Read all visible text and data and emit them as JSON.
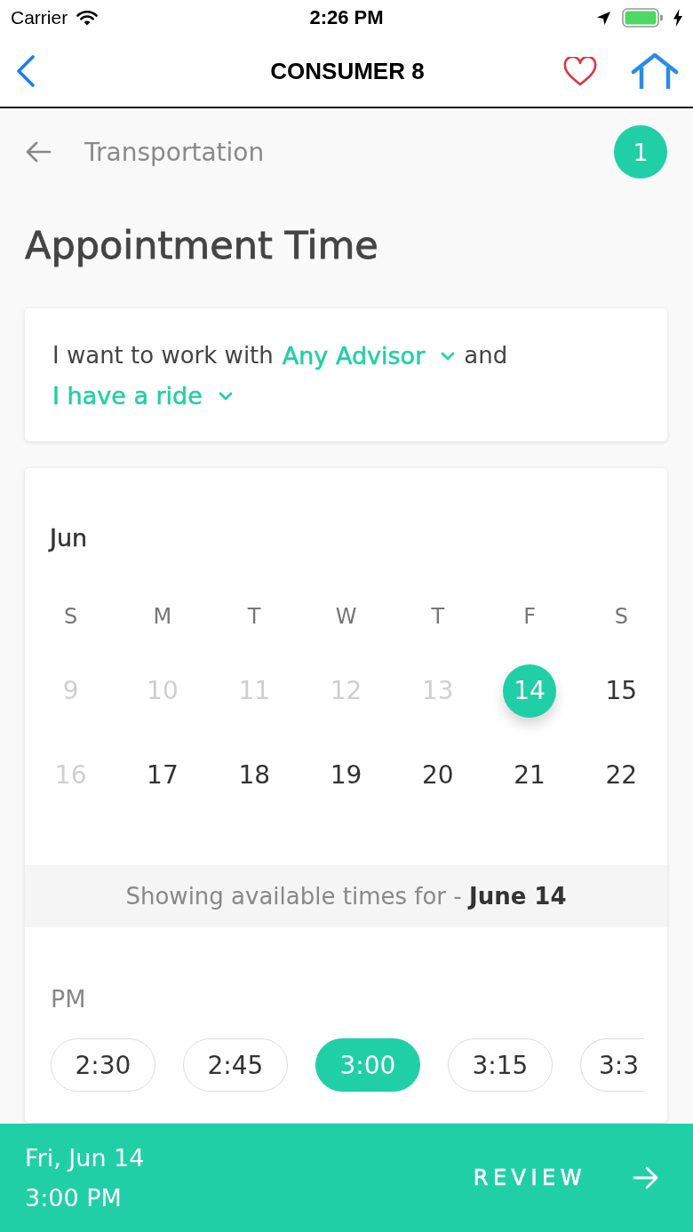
{
  "status_bar": {
    "carrier": "Carrier",
    "time": "2:26 PM"
  },
  "nav_bar": {
    "title": "CONSUMER 8"
  },
  "step_header": {
    "label": "Transportation",
    "badge": "1"
  },
  "page_title": "Appointment Time",
  "preferences": [
    {
      "kind": "text",
      "text": "I want to work with"
    },
    {
      "kind": "dropdown",
      "text": "Any Advisor"
    },
    {
      "kind": "text",
      "text": "and"
    },
    {
      "kind": "dropdown",
      "text": "I have a ride"
    }
  ],
  "calendar": {
    "month": "Jun",
    "weekdays": [
      "S",
      "M",
      "T",
      "W",
      "T",
      "F",
      "S"
    ],
    "weeks": [
      [
        {
          "day": "9",
          "disabled": true,
          "selected": false
        },
        {
          "day": "10",
          "disabled": true,
          "selected": false
        },
        {
          "day": "11",
          "disabled": true,
          "selected": false
        },
        {
          "day": "12",
          "disabled": true,
          "selected": false
        },
        {
          "day": "13",
          "disabled": true,
          "selected": false
        },
        {
          "day": "14",
          "disabled": false,
          "selected": true
        },
        {
          "day": "15",
          "disabled": false,
          "selected": false
        }
      ],
      [
        {
          "day": "16",
          "disabled": true,
          "selected": false
        },
        {
          "day": "17",
          "disabled": false,
          "selected": false
        },
        {
          "day": "18",
          "disabled": false,
          "selected": false
        },
        {
          "day": "19",
          "disabled": false,
          "selected": false
        },
        {
          "day": "20",
          "disabled": false,
          "selected": false
        },
        {
          "day": "21",
          "disabled": false,
          "selected": false
        },
        {
          "day": "22",
          "disabled": false,
          "selected": false
        }
      ]
    ],
    "availability_note": "Showing available times for - **June 14**"
  },
  "times": {
    "period": "PM",
    "slots": [
      {
        "label": "2:30",
        "selected": false
      },
      {
        "label": "2:45",
        "selected": false
      },
      {
        "label": "3:00",
        "selected": true
      },
      {
        "label": "3:15",
        "selected": false
      },
      {
        "label": "3:3",
        "selected": false
      }
    ]
  },
  "summary": {
    "date": "Fri, Jun 14",
    "time": "3:00 PM",
    "action": "REVIEW"
  }
}
